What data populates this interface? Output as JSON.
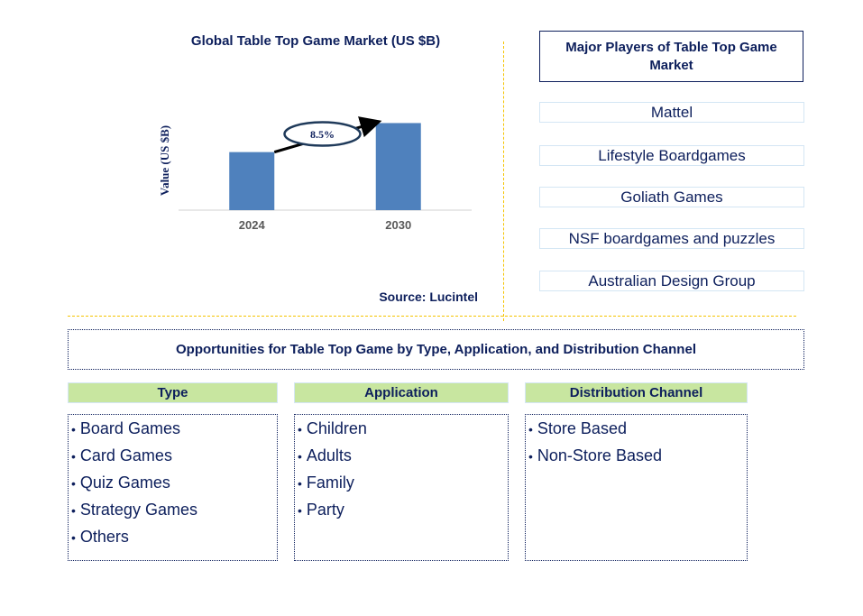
{
  "chart_data": {
    "type": "bar",
    "title": "Global Table Top Game Market (US $B)",
    "xlabel": "",
    "ylabel": "Value (US $B)",
    "categories": [
      "2024",
      "2030"
    ],
    "values": [
      1.0,
      1.5
    ],
    "values_note": "relative bar heights; no y-axis values shown",
    "ylim": [
      0,
      1.6
    ],
    "grid": false,
    "annotation": {
      "label": "8.5%",
      "type": "growth-arrow",
      "from": "2024",
      "to": "2030"
    },
    "bar_color": "#4f81bd"
  },
  "source": "Source: Lucintel",
  "players": {
    "title": "Major Players of Table Top Game Market",
    "items": [
      "Mattel",
      "Lifestyle Boardgames",
      "Goliath Games",
      "NSF boardgames and puzzles",
      "Australian Design Group"
    ]
  },
  "opportunities": {
    "title": "Opportunities for Table Top Game by Type, Application, and Distribution Channel",
    "categories": [
      {
        "header": "Type",
        "items": [
          "Board Games",
          "Card Games",
          "Quiz Games",
          "Strategy Games",
          "Others"
        ]
      },
      {
        "header": "Application",
        "items": [
          "Children",
          "Adults",
          "Family",
          "Party"
        ]
      },
      {
        "header": "Distribution Channel",
        "items": [
          "Store Based",
          "Non-Store Based"
        ]
      }
    ]
  },
  "colors": {
    "text": "#0d1f5c",
    "bar": "#4f81bd",
    "divider": "#f5c400",
    "header_bg": "#c8e6a0",
    "player_border": "#d4e6f4"
  }
}
